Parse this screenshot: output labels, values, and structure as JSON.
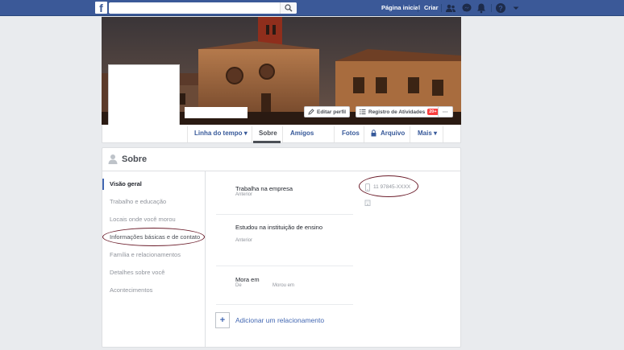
{
  "topbar": {
    "logo": "f",
    "search_placeholder": "",
    "home": "Página inicial",
    "create": "Criar"
  },
  "cover": {
    "edit_profile": "Editar perfil",
    "activity_log": "Registro de Atividades",
    "activity_badge": "20+",
    "more_button": "···"
  },
  "nav": {
    "timeline": "Linha do tempo ▾",
    "about": "Sobre",
    "friends": "Amigos",
    "photos": "Fotos",
    "archive": "Arquivo",
    "more": "Mais ▾"
  },
  "about": {
    "title": "Sobre",
    "sidebar": [
      {
        "label": "Visão geral",
        "active": true
      },
      {
        "label": "Trabalho e educação"
      },
      {
        "label": "Locais onde você morou"
      },
      {
        "label": "Informações básicas e de contato"
      },
      {
        "label": "Família e relacionamentos"
      },
      {
        "label": "Detalhes sobre você"
      },
      {
        "label": "Acontecimentos"
      }
    ],
    "work": {
      "title": "Trabalha na empresa",
      "sub": "Anterior"
    },
    "study": {
      "title": "Estudou na instituição de ensino",
      "sub": "Anterior"
    },
    "lives": {
      "title": "Mora em",
      "sub_from": "De",
      "sub_lived": "Morou em"
    },
    "add_relationship": "Adicionar um relacionamento",
    "add_icon": "+",
    "phone": "11 97845-XXXX"
  },
  "colors": {
    "brand": "#3b5998",
    "link": "#365899",
    "highlight_oval": "#6b1c2a",
    "badge": "#fa3e3e"
  },
  "icons": [
    "facebook-logo",
    "search-icon",
    "friends-icon",
    "messenger-icon",
    "notifications-icon",
    "help-icon",
    "caret-down-icon",
    "pencil-icon",
    "list-icon",
    "lock-icon",
    "user-icon",
    "phone-icon",
    "building-icon",
    "plus-icon"
  ]
}
